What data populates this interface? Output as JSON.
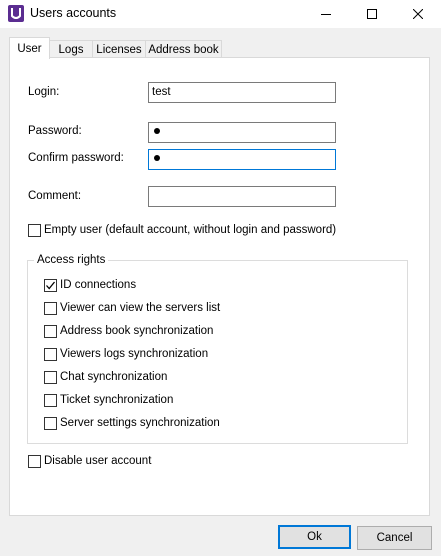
{
  "window": {
    "title": "Users accounts"
  },
  "tabs": [
    {
      "label": "User",
      "active": true
    },
    {
      "label": "Logs",
      "active": false
    },
    {
      "label": "Licenses",
      "active": false
    },
    {
      "label": "Address book",
      "active": false
    }
  ],
  "form": {
    "login": {
      "label": "Login:",
      "value": "test"
    },
    "password": {
      "label": "Password:",
      "masked_chars": 1
    },
    "confirm_password": {
      "label": "Confirm password:",
      "masked_chars": 1
    },
    "comment": {
      "label": "Comment:",
      "value": ""
    },
    "empty_user": {
      "label": "Empty user (default account, without login and password)",
      "checked": false
    }
  },
  "access_rights": {
    "title": "Access rights",
    "items": [
      {
        "label": "ID connections",
        "checked": true
      },
      {
        "label": "Viewer can view the servers list",
        "checked": false
      },
      {
        "label": "Address book synchronization",
        "checked": false
      },
      {
        "label": "Viewers logs synchronization",
        "checked": false
      },
      {
        "label": "Chat synchronization",
        "checked": false
      },
      {
        "label": "Ticket synchronization",
        "checked": false
      },
      {
        "label": "Server settings synchronization",
        "checked": false
      }
    ]
  },
  "disable_account": {
    "label": "Disable user account",
    "checked": false
  },
  "buttons": {
    "ok": "Ok",
    "cancel": "Cancel"
  },
  "colors": {
    "accent": "#0078d7",
    "app_icon": "#5b2d91"
  },
  "icons": {
    "app": "app-logo-icon",
    "minimize": "minimize-icon",
    "maximize": "maximize-icon",
    "close": "close-icon",
    "check": "checkmark-icon"
  }
}
